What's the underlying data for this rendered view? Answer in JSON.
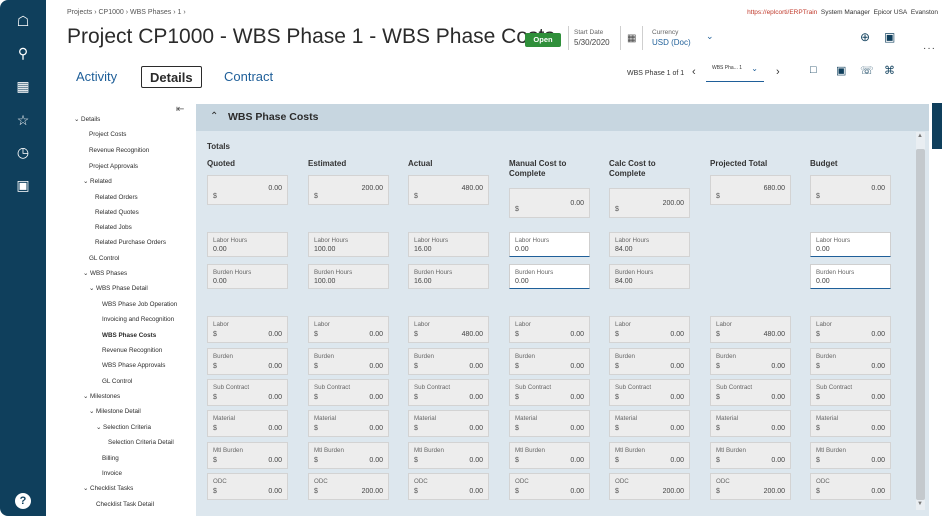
{
  "header": {
    "breadcrumb": "Projects  ›  CP1000  ›  WBS Phases  ›  1  ›",
    "url": "https://eplcorti/ERPTrain",
    "user": "System Manager",
    "company": "Epicor USA",
    "site": "Evanston",
    "title": "Project CP1000 - WBS Phase 1 - WBS Phase Costs",
    "status": "Open",
    "start_date_label": "Start Date",
    "start_date": "5/30/2020",
    "currency_label": "Currency",
    "currency": "USD (Doc)"
  },
  "tabs": [
    {
      "label": "Activity"
    },
    {
      "label": "Details"
    },
    {
      "label": "Contract"
    }
  ],
  "pager": {
    "label": "WBS Phase 1 of 1",
    "selected": "WBS Pha... 1"
  },
  "icons": {
    "rail": [
      "home-icon",
      "search-icon",
      "apps-grid-icon",
      "star-icon",
      "history-icon",
      "dashboard-icon",
      "help-icon"
    ],
    "toolbar": [
      "add-icon",
      "save-icon",
      "new-icon",
      "card-icon",
      "phone-icon",
      "attach-icon",
      "more-icon"
    ]
  },
  "tree": [
    {
      "label": "Details"
    },
    {
      "label": "Project Costs"
    },
    {
      "label": "Revenue Recognition"
    },
    {
      "label": "Project Approvals"
    },
    {
      "label": "Related"
    },
    {
      "label": "Related Orders"
    },
    {
      "label": "Related Quotes"
    },
    {
      "label": "Related Jobs"
    },
    {
      "label": "Related Purchase Orders"
    },
    {
      "label": "GL Control"
    },
    {
      "label": "WBS Phases"
    },
    {
      "label": "WBS Phase Detail"
    },
    {
      "label": "WBS Phase Job Operation"
    },
    {
      "label": "Invoicing and Recognition"
    },
    {
      "label": "WBS Phase Costs"
    },
    {
      "label": "Revenue Recognition"
    },
    {
      "label": "WBS Phase Approvals"
    },
    {
      "label": "GL Control"
    },
    {
      "label": "Milestones"
    },
    {
      "label": "Milestone Detail"
    },
    {
      "label": "Selection Criteria"
    },
    {
      "label": "Selection Criteria Detail"
    },
    {
      "label": "Billing"
    },
    {
      "label": "Invoice"
    },
    {
      "label": "Checklist Tasks"
    },
    {
      "label": "Checklist Task Detail"
    }
  ],
  "panel": {
    "title": "WBS Phase Costs",
    "totals_label": "Totals",
    "currency_symbol": "$",
    "columns": [
      {
        "header": "Quoted",
        "total": "0.00",
        "labor_hours": "0.00",
        "burden_hours": "0.00",
        "labor": "0.00",
        "burden": "0.00",
        "sub_contract": "0.00",
        "material": "0.00",
        "mtl_burden": "0.00",
        "odc": "0.00"
      },
      {
        "header": "Estimated",
        "total": "200.00",
        "labor_hours": "100.00",
        "burden_hours": "100.00",
        "labor": "0.00",
        "burden": "0.00",
        "sub_contract": "0.00",
        "material": "0.00",
        "mtl_burden": "0.00",
        "odc": "200.00"
      },
      {
        "header": "Actual",
        "total": "480.00",
        "labor_hours": "16.00",
        "burden_hours": "16.00",
        "labor": "480.00",
        "burden": "0.00",
        "sub_contract": "0.00",
        "material": "0.00",
        "mtl_burden": "0.00",
        "odc": "0.00"
      },
      {
        "header": "Manual Cost to Complete",
        "total": "0.00",
        "labor_hours": "0.00",
        "burden_hours": "0.00",
        "labor": "0.00",
        "burden": "0.00",
        "sub_contract": "0.00",
        "material": "0.00",
        "mtl_burden": "0.00",
        "odc": "0.00"
      },
      {
        "header": "Calc Cost to Complete",
        "total": "200.00",
        "labor_hours": "84.00",
        "burden_hours": "84.00",
        "labor": "0.00",
        "burden": "0.00",
        "sub_contract": "0.00",
        "material": "0.00",
        "mtl_burden": "0.00",
        "odc": "200.00"
      },
      {
        "header": "Projected Total",
        "total": "680.00",
        "labor": "480.00",
        "burden": "0.00",
        "sub_contract": "0.00",
        "material": "0.00",
        "mtl_burden": "0.00",
        "odc": "200.00"
      },
      {
        "header": "Budget",
        "total": "0.00",
        "labor_hours": "0.00",
        "burden_hours": "0.00",
        "labor": "0.00",
        "burden": "0.00",
        "sub_contract": "0.00",
        "material": "0.00",
        "mtl_burden": "0.00",
        "odc": "0.00"
      }
    ],
    "labels": {
      "labor_hours": "Labor Hours",
      "burden_hours": "Burden Hours",
      "labor": "Labor",
      "burden": "Burden",
      "sub_contract": "Sub Contract",
      "material": "Material",
      "mtl_burden": "Mtl Burden",
      "odc": "ODC"
    }
  }
}
